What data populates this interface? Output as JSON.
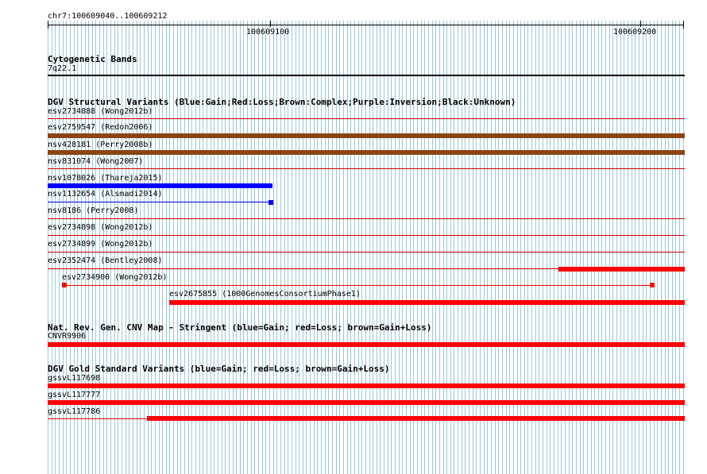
{
  "ruler": {
    "coords": "chr7:100609040..100609212",
    "tick_left": "100609100",
    "tick_right": "100609200"
  },
  "cyto": {
    "title": "Cytogenetic Bands",
    "band": "7q22.1"
  },
  "dgv": {
    "title": "DGV Structural Variants (Blue:Gain;Red:Loss;Brown:Complex;Purple:Inversion;Black:Unknown)",
    "items": [
      {
        "label": "esv2734888 (Wong2012b)",
        "color": "#cc0000",
        "kind": "thin"
      },
      {
        "label": "esv2759547 (Redon2006)",
        "color": "#8b4513",
        "kind": "thick"
      },
      {
        "label": "nsv428181 (Perry2008b)",
        "color": "#8b4513",
        "kind": "thick"
      },
      {
        "label": "nsv831074 (Wong2007)",
        "color": "#cc0000",
        "kind": "thin"
      },
      {
        "label": "nsv1078026 (Thareja2015)",
        "color": "#0000ff",
        "kind": "thick"
      },
      {
        "label": "nsv1132654 (Alsmadi2014)",
        "color": "#0000ff",
        "kind": "thin"
      },
      {
        "label": "nsv8186 (Perry2008)",
        "color": "#cc0000",
        "kind": "thin"
      },
      {
        "label": "esv2734898 (Wong2012b)",
        "color": "#cc0000",
        "kind": "thin"
      },
      {
        "label": "esv2734899 (Wong2012b)",
        "color": "#cc0000",
        "kind": "thin"
      },
      {
        "label": "esv2352474 (Bentley2008)",
        "color": "#ff0000",
        "kind": "thick"
      },
      {
        "label": "esv2734900 (Wong2012b)",
        "color": "#ff0000",
        "kind": "thin"
      },
      {
        "label": "esv2675855 (1000GenomesConsortiumPhase1)",
        "color": "#ff0000",
        "kind": "thick"
      }
    ]
  },
  "cnv": {
    "title": "Nat. Rev. Gen. CNV Map - Stringent (blue=Gain; red=Loss; brown=Gain+Loss)",
    "items": [
      {
        "label": "CNVR9906",
        "color": "#ff0000"
      }
    ]
  },
  "gold": {
    "title": "DGV Gold Standard Variants (blue=Gain; red=Loss; brown=Gain+Loss)",
    "items": [
      {
        "label": "gssvL117698",
        "color": "#ff0000"
      },
      {
        "label": "gssvL117777",
        "color": "#ff0000"
      },
      {
        "label": "gssvL117786",
        "color": "#ff0000"
      }
    ]
  },
  "colors": {
    "grid": "#9ac8d6",
    "loss": "#ff0000",
    "gain": "#0000ff",
    "complex": "#8b4513"
  }
}
